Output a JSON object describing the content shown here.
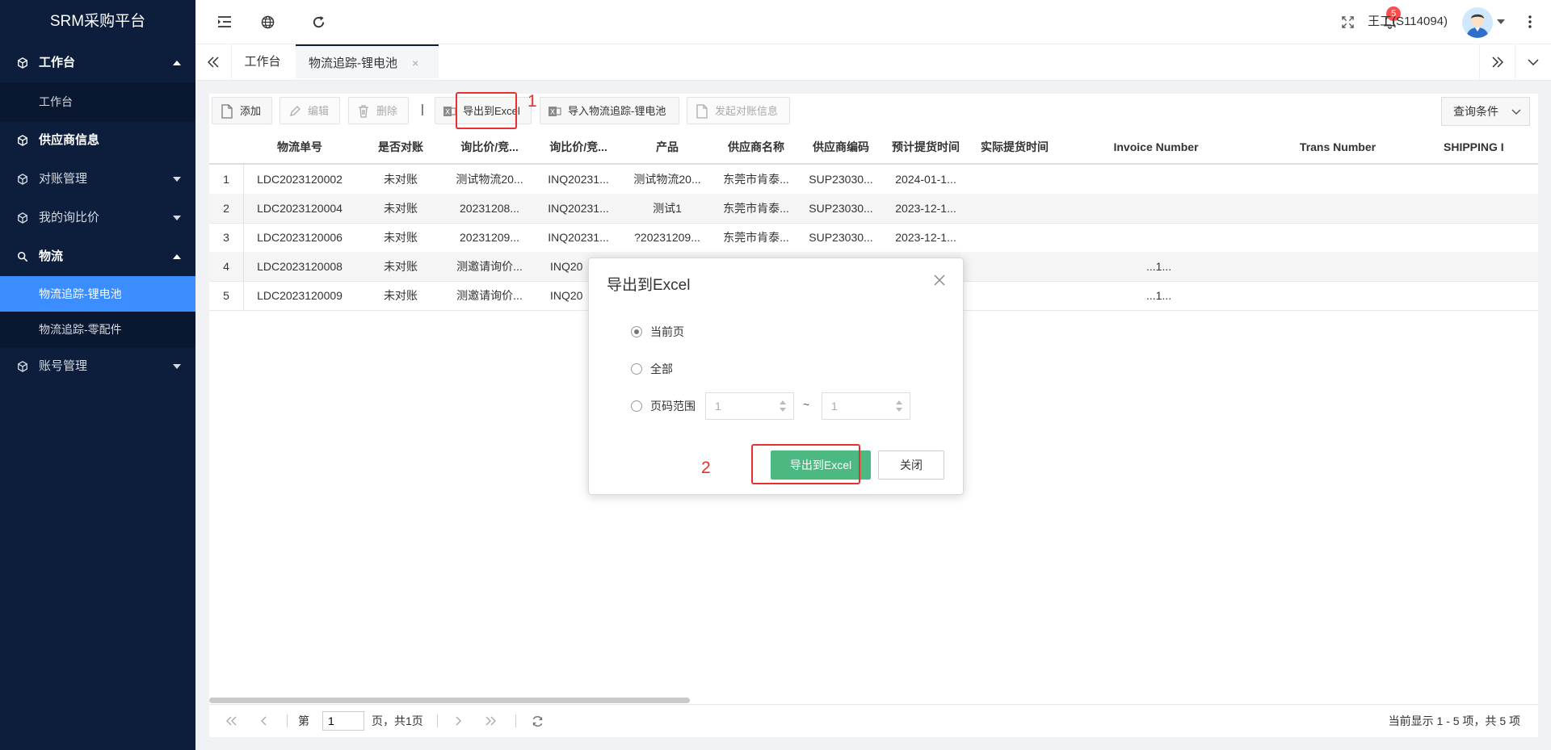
{
  "app": {
    "title": "SRM采购平台"
  },
  "sidebar": {
    "items": [
      {
        "label": "工作台",
        "expanded": true
      },
      {
        "label": "工作台"
      },
      {
        "label": "供应商信息"
      },
      {
        "label": "对账管理",
        "expanded": false
      },
      {
        "label": "我的询比价",
        "expanded": false
      },
      {
        "label": "物流",
        "expanded": true
      },
      {
        "label": "物流追踪-锂电池",
        "active": true
      },
      {
        "label": "物流追踪-零配件"
      },
      {
        "label": "账号管理",
        "expanded": false
      }
    ]
  },
  "header": {
    "notification_count": "5",
    "user": "王工(S114094)"
  },
  "tabs": [
    {
      "label": "工作台"
    },
    {
      "label": "物流追踪-锂电池",
      "active": true,
      "close": "×"
    }
  ],
  "toolbar": {
    "add": "添加",
    "edit": "编辑",
    "delete": "删除",
    "separator": "|",
    "export": "导出到Excel",
    "import": "导入物流追踪-锂电池",
    "reconcile": "发起对账信息",
    "query": "查询条件"
  },
  "annotations": {
    "first": "1",
    "second": "2"
  },
  "table": {
    "columns": [
      "物流单号",
      "是否对账",
      "询比价/竞...",
      "询比价/竞...",
      "产品",
      "供应商名称",
      "供应商编码",
      "预计提货时间",
      "实际提货时间",
      "Invoice Number",
      "Trans Number",
      "SHIPPING I"
    ],
    "rows": [
      {
        "no": "1",
        "cells": [
          "LDC2023120002",
          "未对账",
          "测试物流20...",
          "INQ20231...",
          "测试物流20...",
          "东莞市肯泰...",
          "SUP23030...",
          "2024-01-1..."
        ]
      },
      {
        "no": "2",
        "cells": [
          "LDC2023120004",
          "未对账",
          "20231208...",
          "INQ20231...",
          "测试1",
          "东莞市肯泰...",
          "SUP23030...",
          "2023-12-1..."
        ]
      },
      {
        "no": "3",
        "cells": [
          "LDC2023120006",
          "未对账",
          "20231209...",
          "INQ20231...",
          "?20231209...",
          "东莞市肯泰...",
          "SUP23030...",
          "2023-12-1..."
        ]
      },
      {
        "no": "4",
        "cells": [
          "LDC2023120008",
          "未对账",
          "测邀请询价...",
          "INQ20",
          "",
          "",
          "",
          "...1..."
        ]
      },
      {
        "no": "5",
        "cells": [
          "LDC2023120009",
          "未对账",
          "测邀请询价...",
          "INQ20",
          "",
          "",
          "",
          "...1..."
        ]
      }
    ]
  },
  "pager": {
    "page_prefix": "第",
    "page_value": "1",
    "page_suffix": "页，共1页",
    "summary": "当前显示 1 - 5 项，共 5 项"
  },
  "modal": {
    "title": "导出到Excel",
    "options": [
      "当前页",
      "全部",
      "页码范围"
    ],
    "selected": "当前页",
    "range_from": "1",
    "range_sep": "~",
    "range_to": "1",
    "confirm": "导出到Excel",
    "cancel": "关闭"
  },
  "colors": {
    "sidebar": "#0c1e3c",
    "active": "#3c8dff",
    "primary": "#4cb982",
    "callout": "#e83030",
    "badge": "#ff4d4f"
  }
}
